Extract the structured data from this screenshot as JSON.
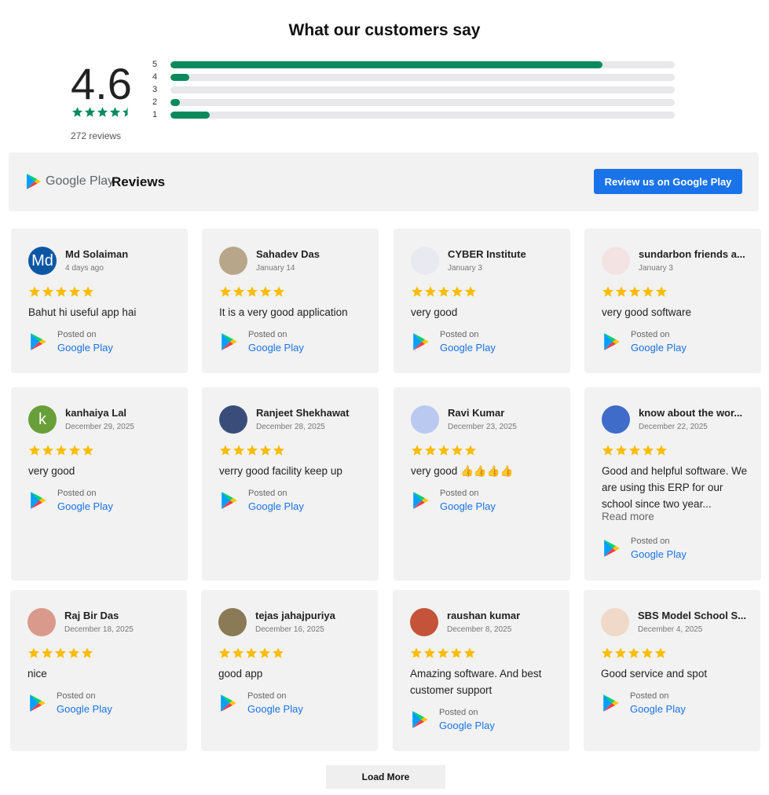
{
  "title": "What our customers say",
  "summary": {
    "rating": "4.6",
    "reviews_text": "272 reviews",
    "bars": [
      {
        "label": "5",
        "fraction": 0.857
      },
      {
        "label": "4",
        "fraction": 0.037
      },
      {
        "label": "3",
        "fraction": 0.0
      },
      {
        "label": "2",
        "fraction": 0.019
      },
      {
        "label": "1",
        "fraction": 0.078
      }
    ],
    "star_color": "#0a8a5c"
  },
  "header": {
    "wordmark": "Google Play",
    "reviews_label": "Reviews",
    "button_label": "Review us on Google Play",
    "button_color": "#1a73e8"
  },
  "colors": {
    "rating_star": "#fbbc04",
    "card_bg": "#f2f2f2",
    "bar_fill": "#0a8a5c"
  },
  "reviews": [
    {
      "name": "Md Solaiman",
      "date": "4 days ago",
      "text": "Bahut hi useful app hai",
      "avatar_letter": "Md",
      "avatar_color": "#0b57a4"
    },
    {
      "name": "Sahadev Das",
      "date": "January 14",
      "text": "It is a very good application",
      "avatar_letter": "",
      "avatar_color": "#b8a68a"
    },
    {
      "name": "CYBER Institute",
      "date": "January 3",
      "text": "very good",
      "avatar_letter": "",
      "avatar_color": "#e9e9f2"
    },
    {
      "name": "sundarbon friends a...",
      "date": "January 3",
      "text": "very good software",
      "avatar_letter": "",
      "avatar_color": "#f3e3e3"
    },
    {
      "name": "kanhaiya Lal",
      "date": "December 29, 2025",
      "text": "very good",
      "avatar_letter": "k",
      "avatar_color": "#689f38"
    },
    {
      "name": "Ranjeet Shekhawat",
      "date": "December 28, 2025",
      "text": "verry good facility keep up",
      "avatar_letter": "",
      "avatar_color": "#3a4d7a"
    },
    {
      "name": "Ravi Kumar",
      "date": "December 23, 2025",
      "text": "very good 👍👍👍👍",
      "avatar_letter": "",
      "avatar_color": "#b9c9ef"
    },
    {
      "name": "know about the wor...",
      "date": "December 22, 2025",
      "text": "Good and helpful software. We are using this ERP for our school since two year...",
      "readmore": "Read more",
      "avatar_letter": "",
      "avatar_color": "#3f6cc8"
    },
    {
      "name": "Raj Bir Das",
      "date": "December 18, 2025",
      "text": "nice",
      "avatar_letter": "",
      "avatar_color": "#d99a8b"
    },
    {
      "name": "tejas jahajpuriya",
      "date": "December 16, 2025",
      "text": "good app",
      "avatar_letter": "",
      "avatar_color": "#8a7a55"
    },
    {
      "name": "raushan kumar",
      "date": "December 8, 2025",
      "text": "Amazing software. And best customer support",
      "avatar_letter": "",
      "avatar_color": "#c4533a"
    },
    {
      "name": "SBS Model School S...",
      "date": "December 4, 2025",
      "text": "Good service and spot",
      "avatar_letter": "",
      "avatar_color": "#f0d9c8"
    }
  ],
  "posted_on": "Posted on",
  "posted_platform": "Google Play",
  "load_more": "Load More"
}
